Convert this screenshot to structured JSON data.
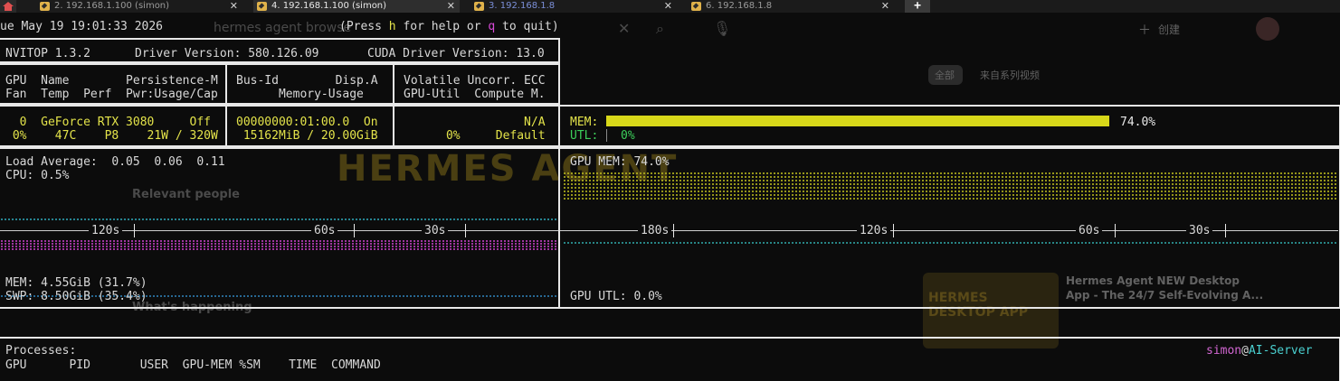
{
  "tabs": [
    {
      "label": "2. 192.168.1.100 (simon)",
      "active": false
    },
    {
      "label": "4. 192.168.1.100 (simon)",
      "active": true
    },
    {
      "label": "3. 192.168.1.8",
      "active": false
    },
    {
      "label": "6. 192.168.1.8",
      "active": false
    }
  ],
  "header": {
    "datetime": "ue May 19 19:01:33 2026",
    "help_pre": "(Press ",
    "help_h": "h",
    "help_mid": " for help or ",
    "help_q": "q",
    "help_post": " to quit)"
  },
  "nvitop": {
    "title": "NVITOP 1.3.2",
    "driver": "Driver Version: 580.126.09",
    "cuda": "CUDA Driver Version: 13.0"
  },
  "gpu_table": {
    "col1_h1": "GPU  Name        Persistence-M",
    "col1_h2": "Fan  Temp  Perf  Pwr:Usage/Cap",
    "col2_h1": "Bus-Id        Disp.A",
    "col2_h2": "      Memory-Usage",
    "col3_h1": "Volatile Uncorr. ECC",
    "col3_h2": "GPU-Util  Compute M.",
    "row1_c1": "  0  GeForce RTX 3080     Off",
    "row2_c1": " 0%    47C    P8    21W / 320W",
    "row1_c2": "00000000:01:00.0  On",
    "row2_c2": " 15162MiB / 20.00GiB",
    "row1_c3": "                 N/A",
    "row2_c3": "      0%     Default"
  },
  "gpu_bars": {
    "mem_label": "MEM:",
    "mem_fraction": 0.74,
    "mem_value": "74.0%",
    "utl_label": "UTL:",
    "utl_value": "0%"
  },
  "host_panel": {
    "load": "Load Average:  0.05  0.06  0.11",
    "cpu": "CPU: 0.5%",
    "mem": "MEM: 4.55GiB (31.7%)",
    "swp": "SWP: 8.50GiB (35.4%)",
    "ticks": [
      "120s",
      "60s",
      "30s"
    ]
  },
  "gpu_panel": {
    "gpu_mem": "GPU MEM: 74.0%",
    "gpu_utl": "GPU UTL: 0.0%",
    "ticks": [
      "180s",
      "120s",
      "60s",
      "30s"
    ]
  },
  "processes": {
    "title": "Processes:",
    "columns": "GPU      PID       USER  GPU-MEM %SM    TIME  COMMAND",
    "user": "simon",
    "at": "@",
    "host": "AI-Server"
  },
  "background": {
    "search": "hermes agent browse",
    "relevant": "Relevant people",
    "happening": "What's happening",
    "tab_all": "全部",
    "tab_series": "来自系列视频",
    "video_title": "Hermes Agent NEW Desktop",
    "video_sub": "App - The 24/7 Self-Evolving A...",
    "create": "创建",
    "desktop_app": "HERMES DESKTOP APP"
  },
  "colors": {
    "mem_bar": "#d7d719",
    "utl": "#3ccf5a",
    "user": "#d266d2",
    "host": "#4ad0d0",
    "key_h": "#e3e34a",
    "key_q": "#d94ad9"
  }
}
